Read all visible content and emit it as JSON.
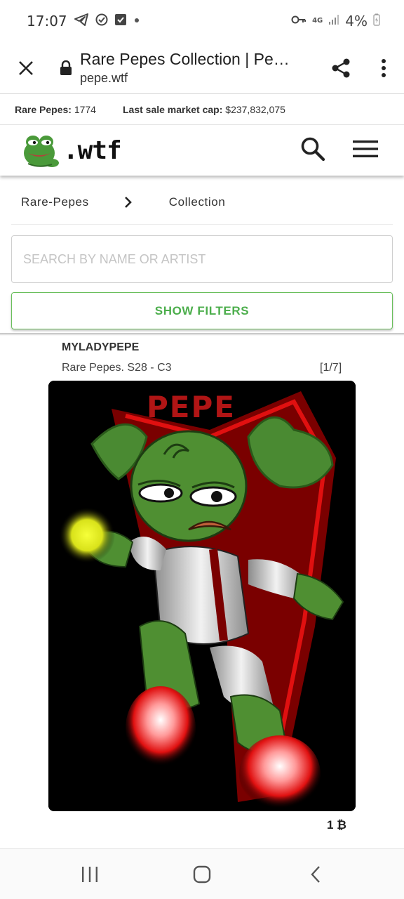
{
  "status_bar": {
    "time": "17:07",
    "network": "4G",
    "battery": "4%",
    "icons": [
      "telegram-icon",
      "check-circle-icon",
      "checkbox-icon",
      "dot-icon",
      "key-icon",
      "signal-icon",
      "battery-charging-icon"
    ]
  },
  "browser": {
    "title": "Rare Pepes Collection | Pepe.wtf",
    "url": "pepe.wtf"
  },
  "stats": {
    "count_label": "Rare Pepes:",
    "count_value": "1774",
    "cap_label": "Last sale market cap:",
    "cap_value": "$237,832,075"
  },
  "site": {
    "logo_text": ".wtf"
  },
  "breadcrumb": {
    "items": [
      "Rare-Pepes",
      "Collection"
    ]
  },
  "search": {
    "placeholder": "SEARCH BY NAME OR ARTIST",
    "value": ""
  },
  "filters": {
    "label": "SHOW FILTERS",
    "accent": "#4cae4c"
  },
  "card": {
    "name": "MYLADYPEPE",
    "series": "Rare Pepes. S28 - C3",
    "count": "[1/7]",
    "art_text": "PEPE",
    "price": "1 ₿"
  }
}
